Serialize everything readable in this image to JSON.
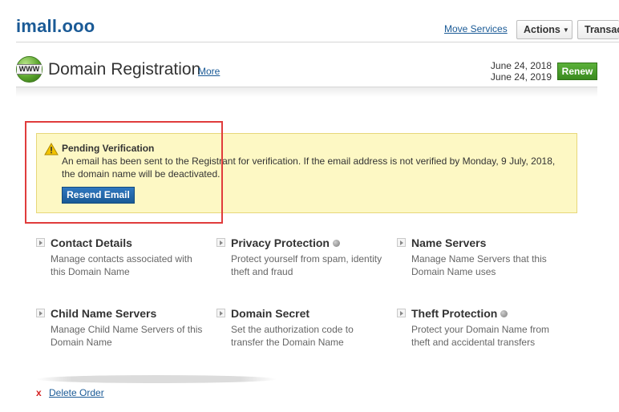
{
  "header": {
    "domain": "imall.ooo",
    "move_services": "Move Services",
    "actions": "Actions",
    "transactions": "Transac"
  },
  "section": {
    "globe_label": "WWW",
    "title": "Domain Registration",
    "more": "More",
    "date_registered": "June 24, 2018",
    "date_expires": "June 24, 2019",
    "renew": "Renew"
  },
  "alert": {
    "title": "Pending Verification",
    "message": "An email has been sent to the Registrant for verification. If the email address is not verified by Monday, 9 July, 2018, the domain name will be deactivated.",
    "button": "Resend Email"
  },
  "tiles": [
    {
      "title": "Contact Details",
      "desc": "Manage contacts associated with this Domain Name"
    },
    {
      "title": "Privacy Protection",
      "desc": "Protect yourself from spam, identity theft and fraud"
    },
    {
      "title": "Name Servers",
      "desc": "Manage Name Servers that this Domain Name uses"
    },
    {
      "title": "Child Name Servers",
      "desc": "Manage Child Name Servers of this Domain Name"
    },
    {
      "title": "Domain Secret",
      "desc": "Set the authorization code to transfer the Domain Name"
    },
    {
      "title": "Theft Protection",
      "desc": "Protect your Domain Name from theft and accidental transfers"
    }
  ],
  "footer": {
    "x_mark": "x",
    "delete_order": "Delete Order"
  },
  "icons": {
    "tile_arrow": "triangle-right-icon",
    "status": "gray-dot-icon",
    "warning": "warning-triangle-icon"
  }
}
